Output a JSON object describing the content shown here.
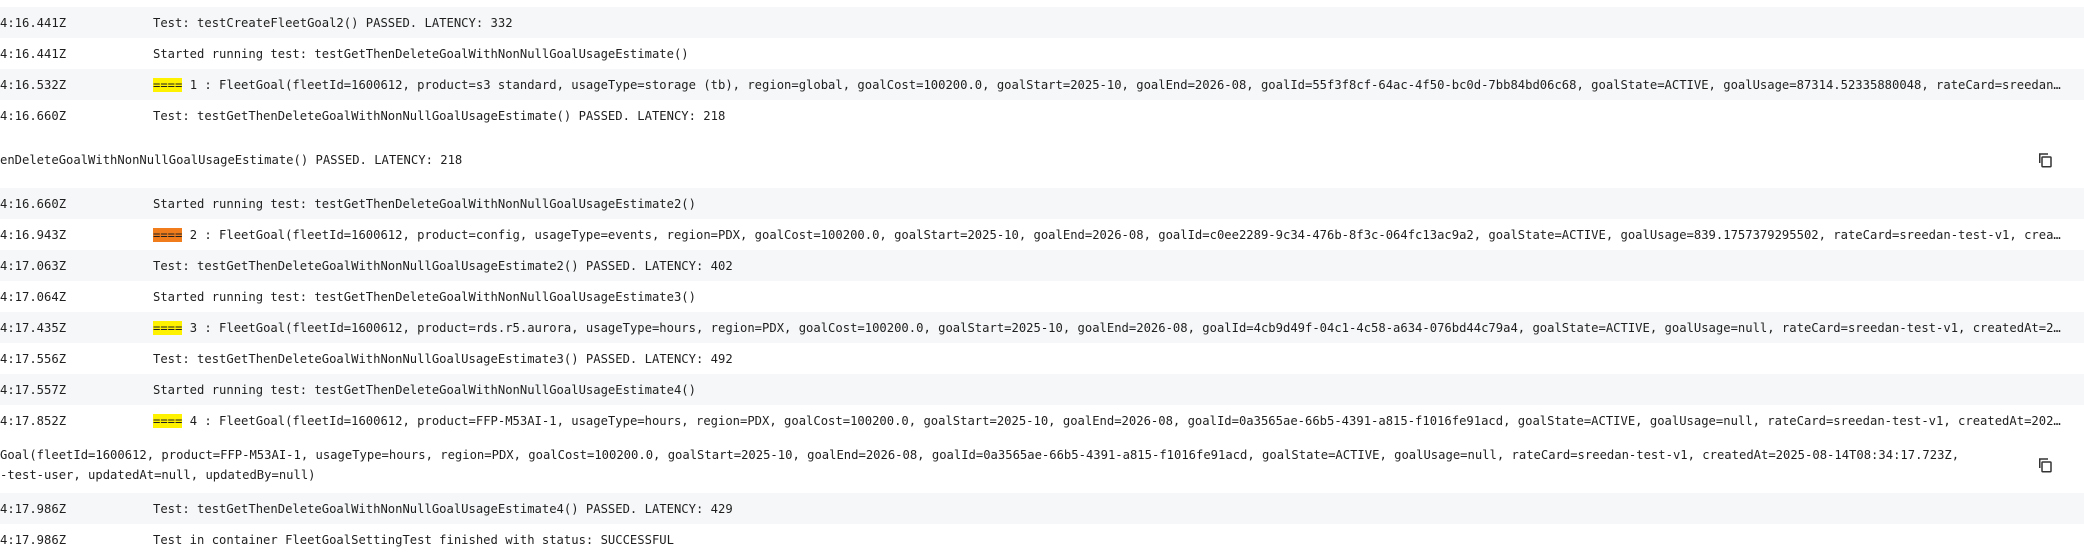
{
  "rows": [
    {
      "ts": "4:16.441Z",
      "msg": "Test: testCreateFleetGoal2() PASSED. LATENCY: 332"
    },
    {
      "ts": "4:16.441Z",
      "msg": "Started running test: testGetThenDeleteGoalWithNonNullGoalUsageEstimate()"
    },
    {
      "ts": "4:16.532Z",
      "mark": "====",
      "msg": " 1 : FleetGoal(fleetId=1600612, product=s3 standard, usageType=storage (tb), region=global, goalCost=100200.0, goalStart=2025-10, goalEnd=2026-08, goalId=55f3f8cf-64ac-4f50-bc0d-7bb84bd06c68, goalState=ACTIVE, goalUsage=87314.52335880048, rateCard=sreedan-t…"
    },
    {
      "ts": "4:16.660Z",
      "msg": "Test: testGetThenDeleteGoalWithNonNullGoalUsageEstimate() PASSED. LATENCY: 218"
    },
    {
      "expanded": "enDeleteGoalWithNonNullGoalUsageEstimate() PASSED. LATENCY: 218"
    },
    {
      "ts": "4:16.660Z",
      "msg": "Started running test: testGetThenDeleteGoalWithNonNullGoalUsageEstimate2()"
    },
    {
      "ts": "4:16.943Z",
      "mark": "====",
      "current": true,
      "msg": " 2 : FleetGoal(fleetId=1600612, product=config, usageType=events, region=PDX, goalCost=100200.0, goalStart=2025-10, goalEnd=2026-08, goalId=c0ee2289-9c34-476b-8f3c-064fc13ac9a2, goalState=ACTIVE, goalUsage=839.1757379295502, rateCard=sreedan-test-v1, create…"
    },
    {
      "ts": "4:17.063Z",
      "msg": "Test: testGetThenDeleteGoalWithNonNullGoalUsageEstimate2() PASSED. LATENCY: 402"
    },
    {
      "ts": "4:17.064Z",
      "msg": "Started running test: testGetThenDeleteGoalWithNonNullGoalUsageEstimate3()"
    },
    {
      "ts": "4:17.435Z",
      "mark": "====",
      "msg": " 3 : FleetGoal(fleetId=1600612, product=rds.r5.aurora, usageType=hours, region=PDX, goalCost=100200.0, goalStart=2025-10, goalEnd=2026-08, goalId=4cb9d49f-04c1-4c58-a634-076bd44c79a4, goalState=ACTIVE, goalUsage=null, rateCard=sreedan-test-v1, createdAt=202…"
    },
    {
      "ts": "4:17.556Z",
      "msg": "Test: testGetThenDeleteGoalWithNonNullGoalUsageEstimate3() PASSED. LATENCY: 492"
    },
    {
      "ts": "4:17.557Z",
      "msg": "Started running test: testGetThenDeleteGoalWithNonNullGoalUsageEstimate4()"
    },
    {
      "ts": "4:17.852Z",
      "mark": "====",
      "msg": " 4 : FleetGoal(fleetId=1600612, product=FFP-M53AI-1, usageType=hours, region=PDX, goalCost=100200.0, goalStart=2025-10, goalEnd=2026-08, goalId=0a3565ae-66b5-4391-a815-f1016fe91acd, goalState=ACTIVE, goalUsage=null, rateCard=sreedan-test-v1, createdAt=2025-…"
    },
    {
      "expanded": "Goal(fleetId=1600612, product=FFP-M53AI-1, usageType=hours, region=PDX, goalCost=100200.0, goalStart=2025-10, goalEnd=2026-08, goalId=0a3565ae-66b5-4391-a815-f1016fe91acd, goalState=ACTIVE, goalUsage=null, rateCard=sreedan-test-v1, createdAt=2025-08-14T08:34:17.723Z,\n-test-user, updatedAt=null, updatedBy=null)"
    },
    {
      "ts": "4:17.986Z",
      "msg": "Test: testGetThenDeleteGoalWithNonNullGoalUsageEstimate4() PASSED. LATENCY: 429"
    },
    {
      "ts": "4:17.986Z",
      "msg": "Test in container FleetGoalSettingTest finished with status: SUCCESSFUL"
    }
  ]
}
